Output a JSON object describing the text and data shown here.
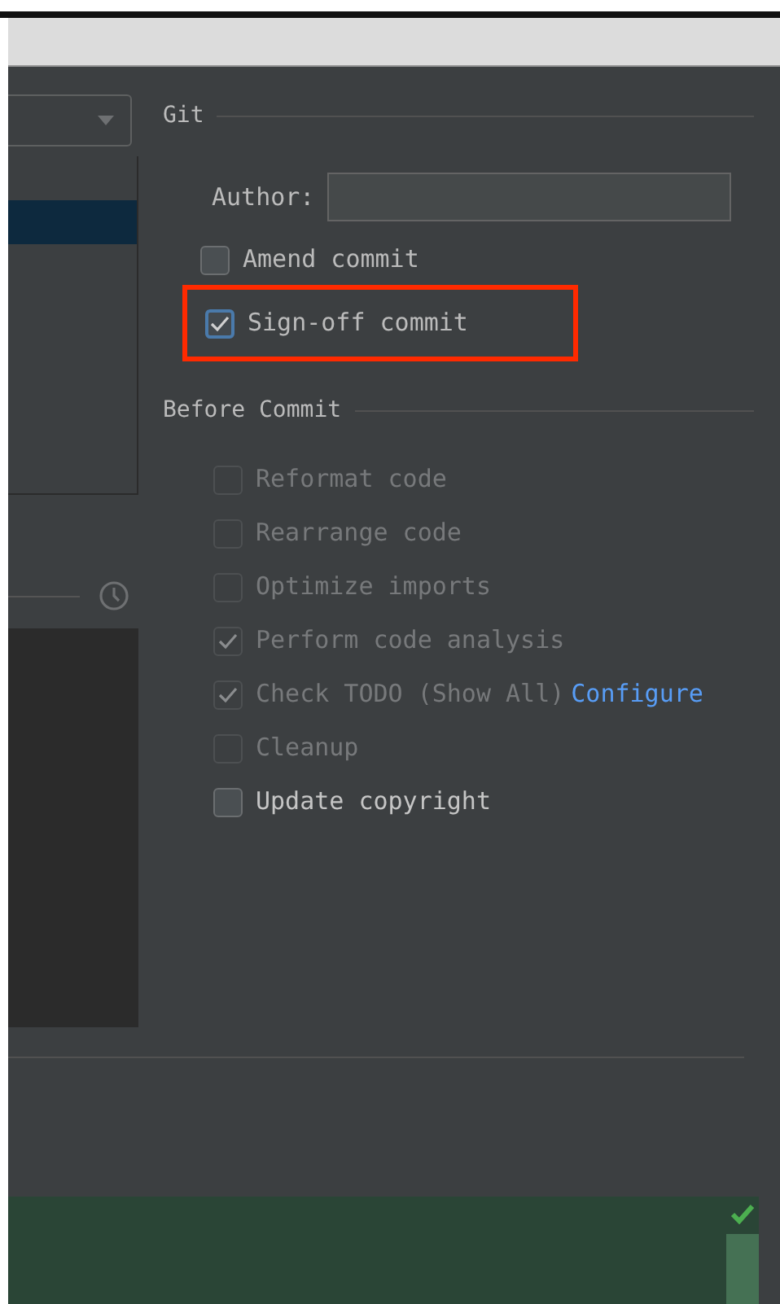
{
  "git": {
    "heading": "Git",
    "author": {
      "label": "Author:"
    },
    "options": [
      {
        "label": "Amend commit",
        "checked": false,
        "highlighted": false
      },
      {
        "label": "Sign-off commit",
        "checked": true,
        "highlighted": true
      }
    ]
  },
  "before_commit": {
    "heading": "Before Commit",
    "options": [
      {
        "label": "Reformat code",
        "checked": false,
        "disabled": true
      },
      {
        "label": "Rearrange code",
        "checked": false,
        "disabled": true
      },
      {
        "label": "Optimize imports",
        "checked": false,
        "disabled": true
      },
      {
        "label": "Perform code analysis",
        "checked": true,
        "disabled": true
      },
      {
        "label": "Check TODO (Show All)",
        "checked": true,
        "disabled": true,
        "link": "Configure"
      },
      {
        "label": "Cleanup",
        "checked": false,
        "disabled": true
      },
      {
        "label": "Update copyright",
        "checked": false,
        "disabled": false
      }
    ]
  }
}
